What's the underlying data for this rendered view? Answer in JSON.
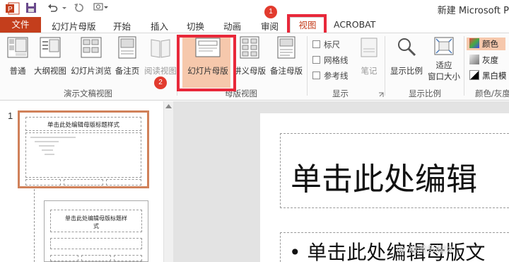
{
  "window": {
    "title": "新建 Microsoft P"
  },
  "quick_access": {
    "icons": [
      "powerpoint-logo-icon",
      "save-icon",
      "undo-icon",
      "redo-icon",
      "customize-icon"
    ]
  },
  "tabs": {
    "file": "文件",
    "items": [
      "幻灯片母版",
      "开始",
      "插入",
      "切换",
      "动画",
      "审阅"
    ],
    "active": "视图",
    "acrobat": "ACROBAT"
  },
  "annotations": {
    "badge1": "1",
    "badge2": "2"
  },
  "ribbon": {
    "presentation_views": {
      "normal": "普通",
      "outline": "大纲视图",
      "slide_sorter": "幻灯片浏览",
      "notes_page": "备注页",
      "reading_view": "阅读视图",
      "label": "演示文稿视图"
    },
    "master_views": {
      "slide_master": "幻灯片母版",
      "handout_master": "讲义母版",
      "notes_master": "备注母版",
      "label": "母版视图"
    },
    "show": {
      "ruler": "标尺",
      "gridlines": "网格线",
      "guides": "参考线",
      "notes": "笔记",
      "label": "显示"
    },
    "zoom": {
      "zoom": "显示比例",
      "fit_line1": "适应",
      "fit_line2": "窗口大小",
      "label": "显示比例"
    },
    "color": {
      "color": "颜色",
      "grayscale": "灰度",
      "bw": "黑白模",
      "label": "颜色/灰度"
    }
  },
  "thumbnails": {
    "slide_number": "1",
    "thumb1_title": "单击此处编辑母版标题样式",
    "thumb2_title_line1": "单击此处编辑母版标题样",
    "thumb2_title_line2": "式"
  },
  "slide": {
    "title": "单击此处编辑",
    "body": "• 单击此处编辑母版文"
  },
  "watermark": "@ 海湾多媒体",
  "colors": {
    "file_tab": "#c43e1c",
    "highlight": "#e8283a",
    "pressed": "#f6c8ac",
    "thumb_selected": "#d0815a"
  }
}
